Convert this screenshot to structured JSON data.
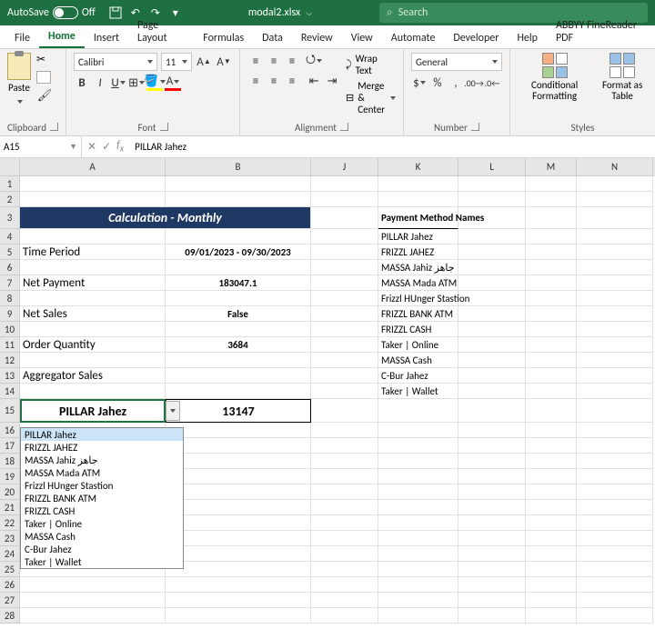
{
  "titlebar": {
    "autosave_label": "AutoSave",
    "autosave_state": "Off",
    "filename": "modal2.xlsx",
    "search_placeholder": "Search"
  },
  "tabs": [
    "File",
    "Home",
    "Insert",
    "Page Layout",
    "Formulas",
    "Data",
    "Review",
    "View",
    "Automate",
    "Developer",
    "Help",
    "ABBYY FineReader PDF"
  ],
  "active_tab": "Home",
  "ribbon": {
    "clipboard": {
      "label": "Clipboard",
      "paste": "Paste"
    },
    "font": {
      "label": "Font",
      "name": "Calibri",
      "size": "11"
    },
    "alignment": {
      "label": "Alignment",
      "wrap": "Wrap Text",
      "merge": "Merge & Center"
    },
    "number": {
      "label": "Number",
      "format": "General"
    },
    "styles": {
      "label": "Styles",
      "cf": "Conditional Formatting",
      "fmt": "Format as Table"
    }
  },
  "namebox": "A15",
  "formula": "PILLAR Jahez",
  "col_headers": [
    "A",
    "B",
    "J",
    "K",
    "L",
    "M",
    "N"
  ],
  "sheet": {
    "title": "Calculation - Monthly",
    "labels": {
      "time_period": "Time Period",
      "net_payment": "Net Payment",
      "net_sales": "Net Sales",
      "order_qty": "Order Quantity",
      "agg_sales": "Aggregator Sales",
      "pm_header": "Payment Method Names"
    },
    "values": {
      "time_period": "09/01/2023 - 09/30/2023",
      "net_payment": "183047.1",
      "net_sales": "False",
      "order_qty": "3684",
      "a15": "PILLAR Jahez",
      "b15": "13147"
    },
    "payment_methods": [
      "PILLAR Jahez",
      "FRIZZL JAHEZ",
      "MASSA Jahiz جاهز",
      "MASSA Mada ATM",
      "Frizzl HUnger Stastion",
      "FRIZZL BANK ATM",
      "FRIZZL CASH",
      "Taker | Online",
      "MASSA Cash",
      "C-Bur Jahez",
      "Taker | Wallet"
    ]
  },
  "dropdown_items": [
    "PILLAR Jahez",
    "FRIZZL JAHEZ",
    "MASSA Jahiz جاهز",
    "MASSA Mada ATM",
    "Frizzl HUnger Stastion",
    "FRIZZL BANK ATM",
    "FRIZZL CASH",
    "Taker | Online",
    "MASSA Cash",
    "C-Bur Jahez",
    "Taker | Wallet"
  ]
}
